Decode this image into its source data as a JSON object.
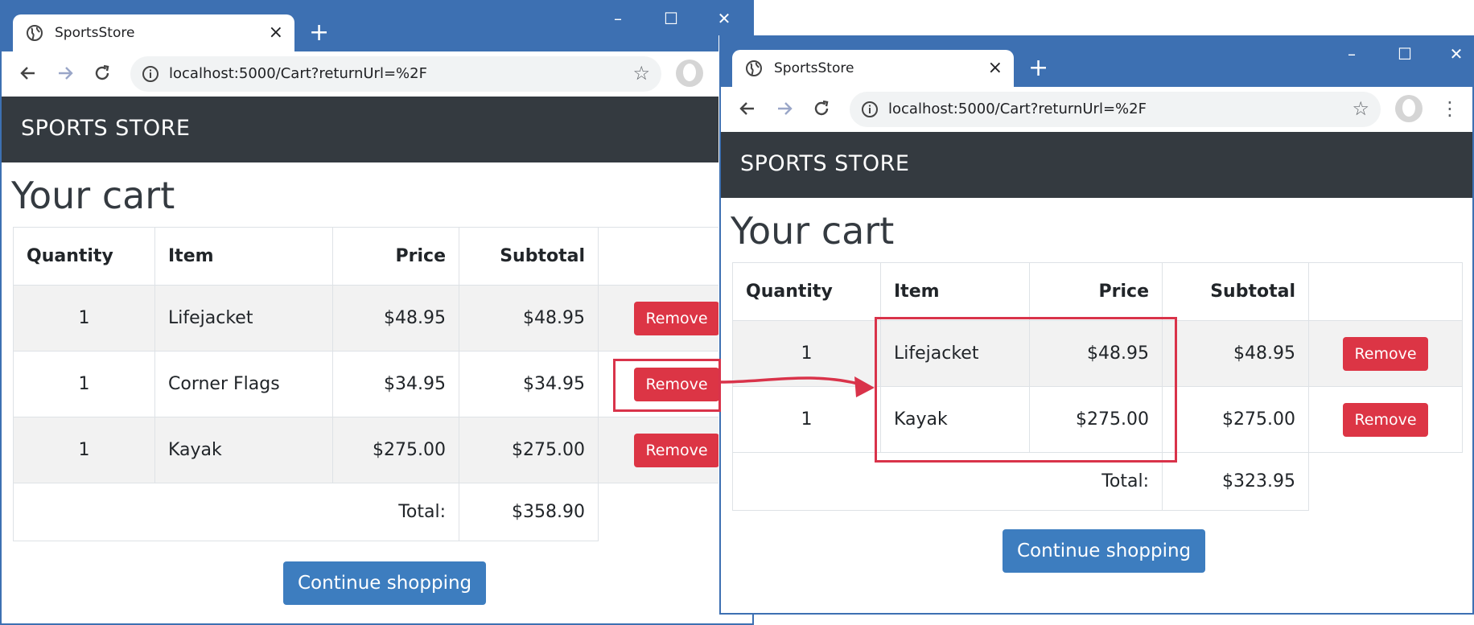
{
  "left": {
    "tab_title": "SportsStore",
    "tab_close": "×",
    "new_tab": "+",
    "minimize": "–",
    "maximize": "☐",
    "close": "✕",
    "url": "localhost:5000/Cart?returnUrl=%2F",
    "brand": "SPORTS STORE",
    "heading": "Your cart",
    "columns": [
      "Quantity",
      "Item",
      "Price",
      "Subtotal"
    ],
    "rows": [
      {
        "quantity": "1",
        "item": "Lifejacket",
        "price": "$48.95",
        "subtotal": "$48.95",
        "action": "Remove"
      },
      {
        "quantity": "1",
        "item": "Corner Flags",
        "price": "$34.95",
        "subtotal": "$34.95",
        "action": "Remove"
      },
      {
        "quantity": "1",
        "item": "Kayak",
        "price": "$275.00",
        "subtotal": "$275.00",
        "action": "Remove"
      }
    ],
    "total_label": "Total:",
    "total_value": "$358.90",
    "continue": "Continue shopping"
  },
  "right": {
    "tab_title": "SportsStore",
    "tab_close": "×",
    "new_tab": "+",
    "minimize": "–",
    "maximize": "☐",
    "close": "✕",
    "url": "localhost:5000/Cart?returnUrl=%2F",
    "menu": "⋮",
    "brand": "SPORTS STORE",
    "heading": "Your cart",
    "columns": [
      "Quantity",
      "Item",
      "Price",
      "Subtotal"
    ],
    "rows": [
      {
        "quantity": "1",
        "item": "Lifejacket",
        "price": "$48.95",
        "subtotal": "$48.95",
        "action": "Remove"
      },
      {
        "quantity": "1",
        "item": "Kayak",
        "price": "$275.00",
        "subtotal": "$275.00",
        "action": "Remove"
      }
    ],
    "total_label": "Total:",
    "total_value": "$323.95",
    "continue": "Continue shopping"
  },
  "colors": {
    "chrome_blue": "#3d70b2",
    "navbar": "#343a40",
    "danger": "#dc3545",
    "primary": "#3d7dbf",
    "annotation": "#d9334a"
  },
  "icons": [
    "globe-icon",
    "back-icon",
    "forward-icon",
    "reload-icon",
    "info-icon",
    "star-icon",
    "profile-icon"
  ]
}
